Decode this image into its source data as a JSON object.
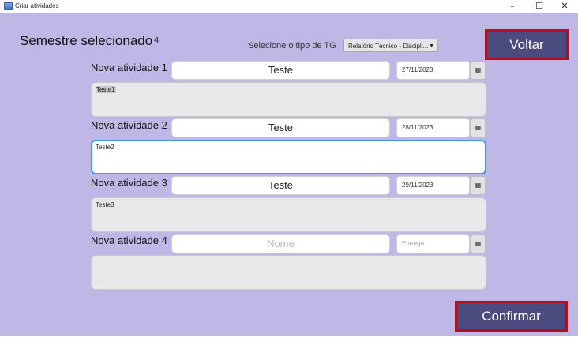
{
  "window": {
    "title": "Criar atividades",
    "minimize_icon": "minimize-icon",
    "maximize_icon": "maximize-icon",
    "close_icon": "close-icon"
  },
  "header": {
    "semestre_label": "Semestre selecionado",
    "semestre_value": "4",
    "tipo_label": "Selecione o tipo de TG",
    "tipo_selected": "Relatório Técnico - Discipli...",
    "voltar_label": "Voltar"
  },
  "activities": [
    {
      "label": "Nova atividade 1",
      "name_value": "Teste",
      "name_placeholder": "",
      "date_value": "27/11/2023",
      "date_placeholder": "",
      "description": "Teste1"
    },
    {
      "label": "Nova atividade 2",
      "name_value": "Teste",
      "name_placeholder": "",
      "date_value": "28/11/2023",
      "date_placeholder": "",
      "description": "Teste2"
    },
    {
      "label": "Nova atividade 3",
      "name_value": "Teste",
      "name_placeholder": "",
      "date_value": "29/11/2023",
      "date_placeholder": "",
      "description": "Teste3"
    },
    {
      "label": "Nova atividade 4",
      "name_value": "",
      "name_placeholder": "Nome",
      "date_value": "",
      "date_placeholder": "Entrega",
      "description": ""
    }
  ],
  "footer": {
    "confirmar_label": "Confirmar"
  },
  "colors": {
    "background": "#bfb8e6",
    "button_fill": "#4c4b80",
    "button_border": "#b40d1e",
    "focus_border": "#3c9ad8"
  }
}
